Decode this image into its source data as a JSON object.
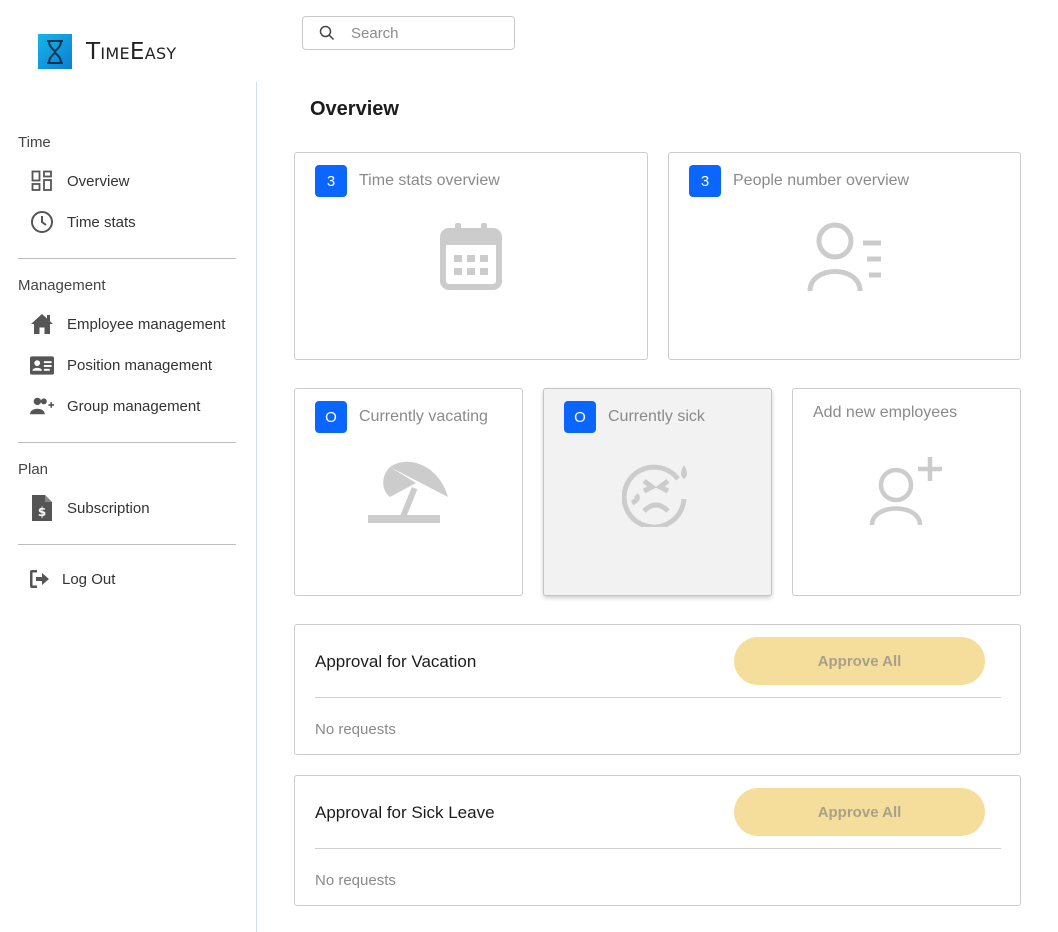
{
  "app": {
    "name": "TimeEasy"
  },
  "search": {
    "placeholder": "Search"
  },
  "sidebar": {
    "sections": [
      {
        "title": "Time",
        "items": [
          {
            "label": "Overview",
            "icon": "dashboard-icon"
          },
          {
            "label": "Time stats",
            "icon": "clock-icon"
          }
        ]
      },
      {
        "title": "Management",
        "items": [
          {
            "label": "Employee management",
            "icon": "home-icon"
          },
          {
            "label": "Position management",
            "icon": "id-card-icon"
          },
          {
            "label": "Group management",
            "icon": "group-add-icon"
          }
        ]
      },
      {
        "title": "Plan",
        "items": [
          {
            "label": "Subscription",
            "icon": "invoice-icon"
          }
        ]
      }
    ],
    "logout": {
      "label": "Log Out",
      "icon": "logout-icon"
    }
  },
  "main": {
    "title": "Overview",
    "cards": {
      "time_stats": {
        "count": "3",
        "title": "Time stats overview",
        "icon": "calendar-icon"
      },
      "people": {
        "count": "3",
        "title": "People number overview",
        "icon": "person-list-icon"
      },
      "vacating": {
        "count": "O",
        "title": "Currently vacating",
        "icon": "beach-umbrella-icon"
      },
      "sick": {
        "count": "O",
        "title": "Currently sick",
        "icon": "sick-face-icon"
      },
      "add": {
        "title": "Add new employees",
        "icon": "person-add-icon"
      }
    },
    "approvals": {
      "vacation": {
        "title": "Approval for Vacation",
        "button": "Approve All",
        "empty": "No requests"
      },
      "sick": {
        "title": "Approval for Sick Leave",
        "button": "Approve All",
        "empty": "No requests"
      }
    }
  },
  "colors": {
    "badge": "#0b66ff",
    "approve_button": "#f5de9b",
    "icon_gray": "#cccccc",
    "logo": "#18b4e8"
  }
}
